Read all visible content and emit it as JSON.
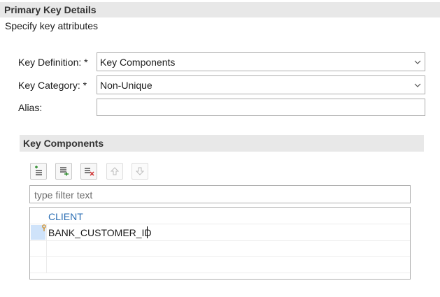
{
  "section": {
    "title": "Primary Key Details",
    "subtitle": "Specify key attributes"
  },
  "form": {
    "key_definition": {
      "label": "Key Definition: *",
      "value": "Key Components"
    },
    "key_category": {
      "label": "Key Category: *",
      "value": "Non-Unique"
    },
    "alias": {
      "label": "Alias:",
      "value": ""
    }
  },
  "components": {
    "title": "Key Components",
    "toolbar": {
      "add": "add-component-icon",
      "insert": "insert-component-icon",
      "remove": "remove-component-icon",
      "move_up": "move-up-icon",
      "move_down": "move-down-icon"
    },
    "filter": {
      "placeholder": "type filter text",
      "value": ""
    },
    "table": {
      "header": "CLIENT",
      "rows": [
        "BANK_CUSTOMER_ID"
      ]
    }
  },
  "colors": {
    "header_bg": "#e8e8e8",
    "column_header": "#2a6db3",
    "selection": "#cfe3fa"
  }
}
